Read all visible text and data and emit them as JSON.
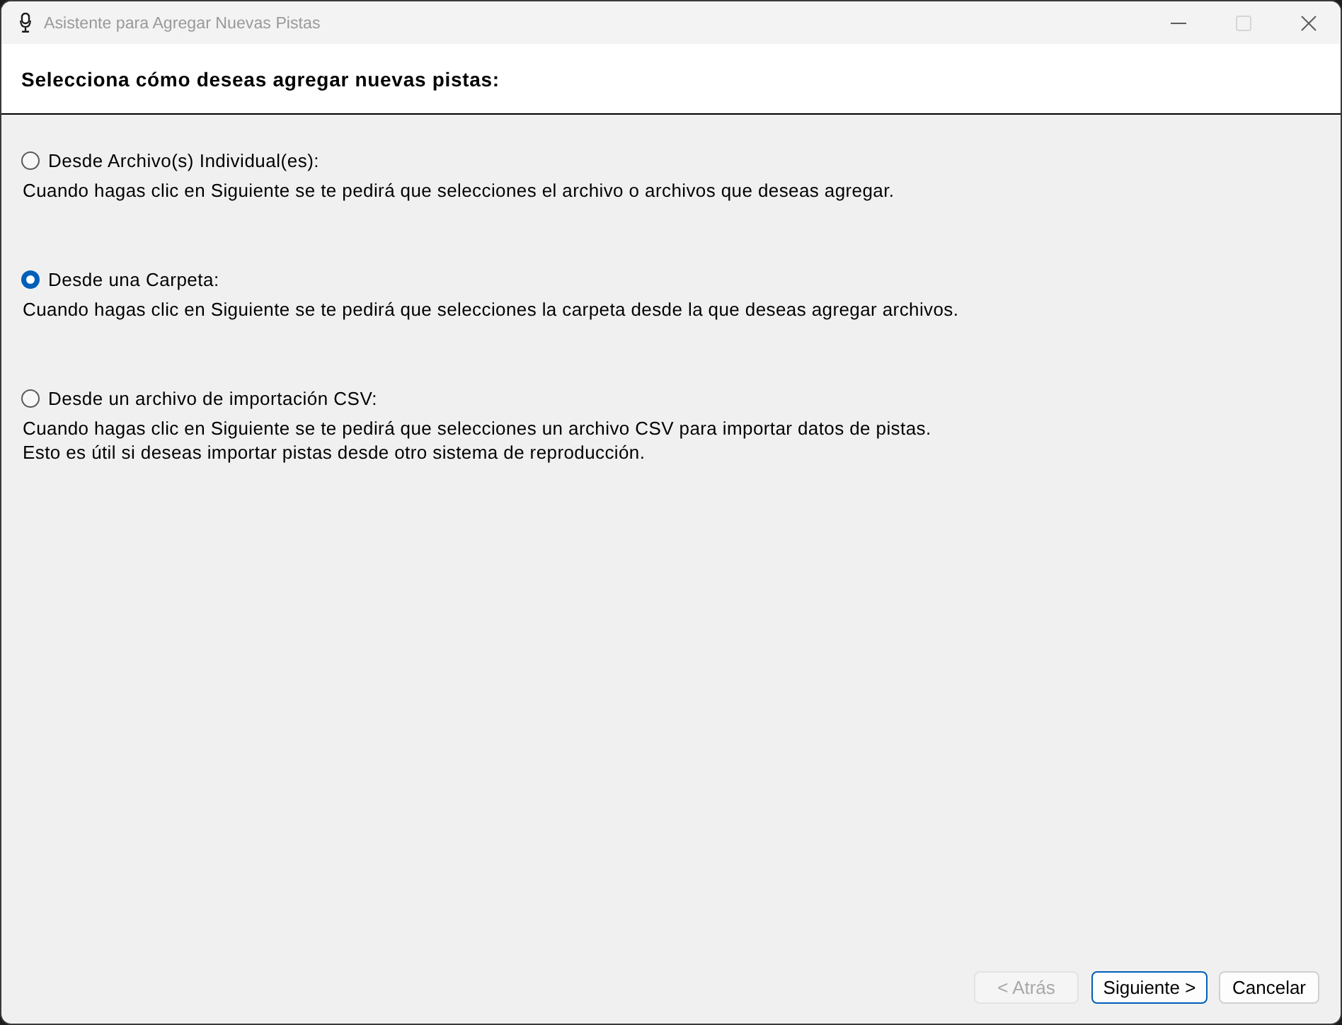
{
  "window": {
    "title": "Asistente para Agregar Nuevas Pistas",
    "controls": [
      {
        "kind": "minimize",
        "disabled": false
      },
      {
        "kind": "maximize",
        "disabled": true
      },
      {
        "kind": "close",
        "disabled": false
      }
    ]
  },
  "header": {
    "heading": "Selecciona cómo deseas agregar nuevas pistas:"
  },
  "options": [
    {
      "label": "Desde Archivo(s) Individual(es):",
      "selected": false,
      "description": [
        "Cuando hagas clic en Siguiente se te pedirá que selecciones el archivo o archivos que deseas agregar."
      ]
    },
    {
      "label": "Desde una Carpeta:",
      "selected": true,
      "description": [
        "Cuando hagas clic en Siguiente se te pedirá que selecciones la carpeta desde la que deseas agregar archivos."
      ]
    },
    {
      "label": "Desde un archivo de importación CSV:",
      "selected": false,
      "description": [
        "Cuando hagas clic en Siguiente se te pedirá que selecciones un archivo CSV para importar datos de pistas.",
        "Esto es útil si deseas importar pistas desde otro sistema de reproducción."
      ]
    }
  ],
  "buttons": [
    {
      "label": "< Atrás",
      "disabled": true,
      "default": false
    },
    {
      "label": "Siguiente >",
      "disabled": false,
      "default": true
    },
    {
      "label": "Cancelar",
      "disabled": false,
      "default": false
    }
  ]
}
